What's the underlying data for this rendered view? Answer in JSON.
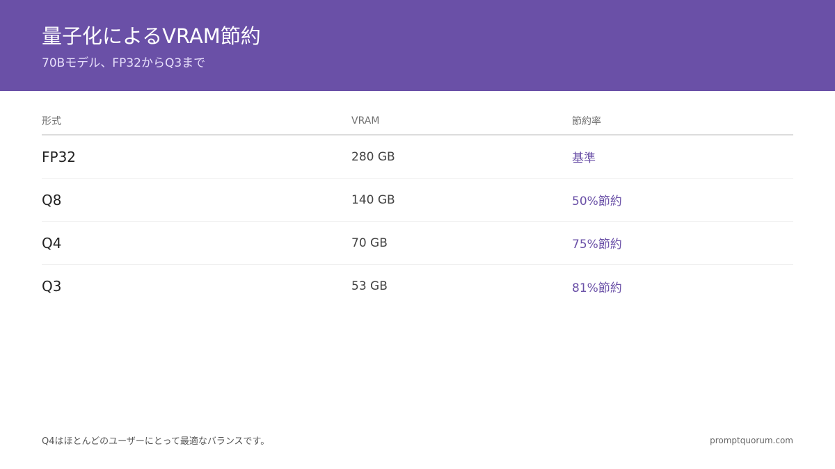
{
  "colors": {
    "header_bg": "#6a50a7",
    "header_subtitle": "#e6defa",
    "accent": "#6a50a7"
  },
  "header": {
    "title": "量子化によるVRAM節約",
    "subtitle": "70Bモデル、FP32からQ3まで"
  },
  "table": {
    "columns": [
      "形式",
      "VRAM",
      "節約率"
    ],
    "rows": [
      [
        "FP32",
        "280 GB",
        "基準"
      ],
      [
        "Q8",
        "140 GB",
        "50%節約"
      ],
      [
        "Q4",
        "70 GB",
        "75%節約"
      ],
      [
        "Q3",
        "53 GB",
        "81%節約"
      ]
    ]
  },
  "footer": {
    "note": "Q4はほとんどのユーザーにとって最適なバランスです。",
    "site": "promptquorum.com"
  }
}
